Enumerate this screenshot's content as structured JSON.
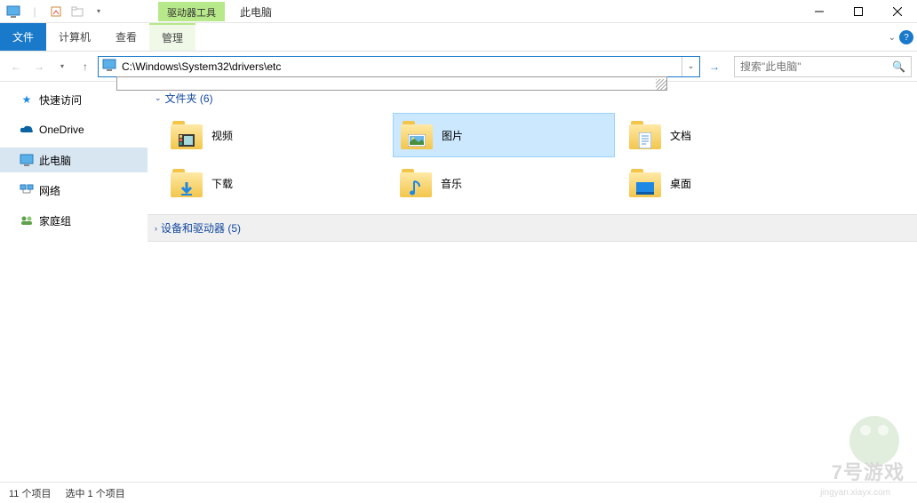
{
  "title": "此电脑",
  "context_tab": "驱动器工具",
  "ribbon": {
    "file": "文件",
    "computer": "计算机",
    "view": "查看",
    "manage": "管理"
  },
  "nav": {
    "address": "C:\\Windows\\System32\\drivers\\etc",
    "search_placeholder": "搜索\"此电脑\""
  },
  "sidebar": [
    {
      "label": "快速访问",
      "icon": "star",
      "color": "#1e88e5"
    },
    {
      "label": "OneDrive",
      "icon": "cloud",
      "color": "#0a64a4"
    },
    {
      "label": "此电脑",
      "icon": "monitor",
      "color": "#1e88e5",
      "selected": true
    },
    {
      "label": "网络",
      "icon": "network",
      "color": "#1e88e5"
    },
    {
      "label": "家庭组",
      "icon": "homegroup",
      "color": "#5ea14b"
    }
  ],
  "groups": {
    "folders": {
      "label": "文件夹",
      "count": 6,
      "expanded": true
    },
    "devices": {
      "label": "设备和驱动器",
      "count": 5,
      "expanded": false
    }
  },
  "folders": [
    {
      "label": "视频",
      "overlay": "video"
    },
    {
      "label": "图片",
      "overlay": "picture",
      "selected": true
    },
    {
      "label": "文档",
      "overlay": "doc"
    },
    {
      "label": "下载",
      "overlay": "download"
    },
    {
      "label": "音乐",
      "overlay": "music"
    },
    {
      "label": "桌面",
      "overlay": "desktop"
    }
  ],
  "status": {
    "items": "11 个项目",
    "selected": "选中 1 个项目"
  },
  "watermark": {
    "brand": "7号游戏",
    "url": "jingyan.xiayx.com"
  }
}
